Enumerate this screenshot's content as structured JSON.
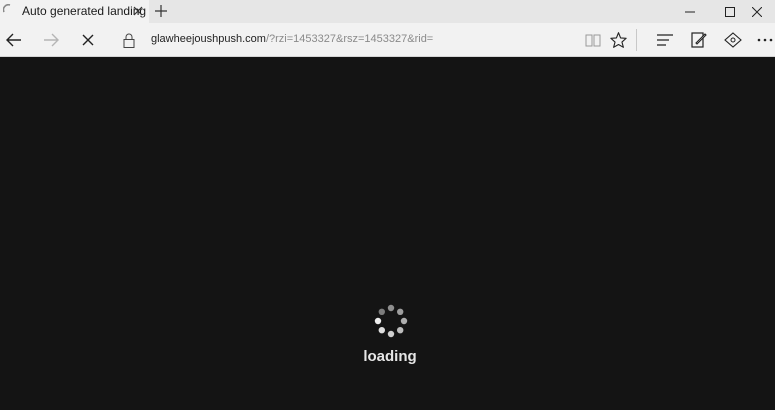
{
  "tab": {
    "title": "Auto generated landing"
  },
  "address_bar": {
    "host": "glawheejoushpush.com",
    "query": "/?rzi=1453327&rsz=1453327&rid="
  },
  "page": {
    "loading_text": "loading"
  },
  "icons": {
    "tab_spinner": "loading-spinner-icon",
    "tab_close": "close-icon",
    "new_tab": "plus-icon",
    "minimize": "minimize-icon",
    "maximize": "maximize-icon",
    "close_window": "close-icon",
    "back": "arrow-left-icon",
    "forward": "arrow-right-icon",
    "stop": "close-icon",
    "lock": "lock-icon",
    "reading_view": "book-icon",
    "favorite": "star-icon",
    "hub": "hub-icon",
    "web_note": "pen-icon",
    "share": "share-icon",
    "more": "more-dots-icon",
    "page_loader": "loading-spinner-icon"
  },
  "colors": {
    "page_background": "#141414",
    "chrome_background": "#f2f2f2",
    "tabstrip_background": "#e6e6e6",
    "loading_text": "#e6e6e6"
  }
}
